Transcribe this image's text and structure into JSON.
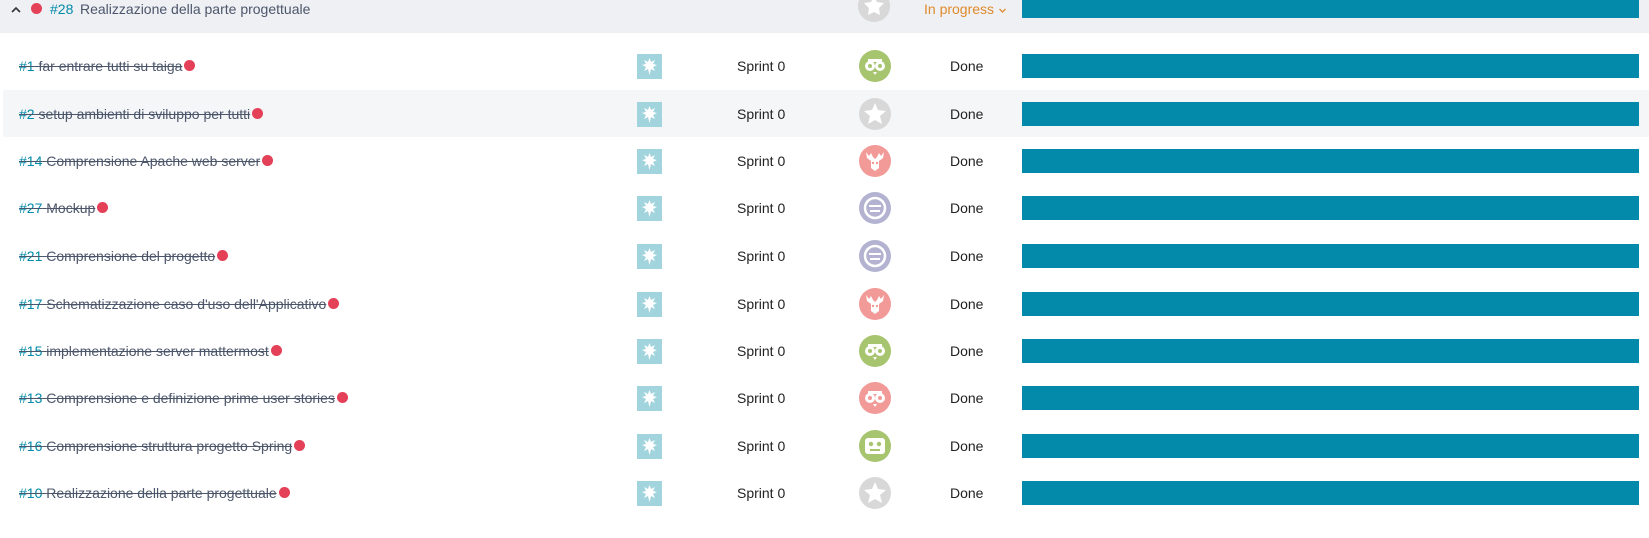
{
  "parent_story": {
    "ref": "#28",
    "subject": "Realizzazione della parte progettuale",
    "status": "In progress",
    "status_icon": "chevron-down-icon",
    "collapse_icon": "chevron-up-icon",
    "dot_color": "#e44057",
    "progress": 1.0
  },
  "colors": {
    "accent": "#008aa8",
    "bar": "#0389a9",
    "blocked_dot": "#e44057",
    "in_progress": "#e08a2b"
  },
  "tasks": [
    {
      "ref": "#1",
      "subject": "far entrare tutti su taiga",
      "sprint": "Sprint 0",
      "status": "Done",
      "avatar_color": "#a7c46f",
      "avatar_icon": "owl-avatar-icon",
      "progress": 1.0
    },
    {
      "ref": "#2",
      "subject": "setup ambienti di sviluppo per tutti",
      "sprint": "Sprint 0",
      "status": "Done",
      "avatar_color": "#d8d8d8",
      "avatar_icon": "star-avatar-icon",
      "progress": 1.0
    },
    {
      "ref": "#14",
      "subject": "Comprensione Apache web server",
      "sprint": "Sprint 0",
      "status": "Done",
      "avatar_color": "#f19a97",
      "avatar_icon": "moose-avatar-icon",
      "progress": 1.0
    },
    {
      "ref": "#27",
      "subject": "Mockup",
      "sprint": "Sprint 0",
      "status": "Done",
      "avatar_color": "#b3b3d1",
      "avatar_icon": "cat-avatar-icon",
      "progress": 1.0
    },
    {
      "ref": "#21",
      "subject": "Comprensione del progetto",
      "sprint": "Sprint 0",
      "status": "Done",
      "avatar_color": "#b3b3d1",
      "avatar_icon": "cat-avatar-icon",
      "progress": 1.0
    },
    {
      "ref": "#17",
      "subject": "Schematizzazione caso d'uso dell'Applicativo",
      "sprint": "Sprint 0",
      "status": "Done",
      "avatar_color": "#f19a97",
      "avatar_icon": "moose-avatar-icon",
      "progress": 1.0
    },
    {
      "ref": "#15",
      "subject": "implementazione server mattermost",
      "sprint": "Sprint 0",
      "status": "Done",
      "avatar_color": "#a7c46f",
      "avatar_icon": "owl-avatar-icon",
      "progress": 1.0
    },
    {
      "ref": "#13",
      "subject": "Comprensione e definizione prime user stories",
      "sprint": "Sprint 0",
      "status": "Done",
      "avatar_color": "#f19a97",
      "avatar_icon": "owl-avatar-icon",
      "progress": 1.0
    },
    {
      "ref": "#16",
      "subject": "Comprensione struttura progetto Spring",
      "sprint": "Sprint 0",
      "status": "Done",
      "avatar_color": "#a7c46f",
      "avatar_icon": "frog-avatar-icon",
      "progress": 1.0
    },
    {
      "ref": "#10",
      "subject": "Realizzazione della parte progettuale",
      "sprint": "Sprint 0",
      "status": "Done",
      "avatar_color": "#d8d8d8",
      "avatar_icon": "star-avatar-icon",
      "progress": 1.0
    }
  ]
}
